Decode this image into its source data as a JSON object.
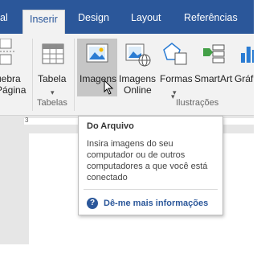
{
  "tabs": {
    "partial_left": "al",
    "inserir": "Inserir",
    "design": "Design",
    "layout": "Layout",
    "referencias": "Referências"
  },
  "ribbon": {
    "quebra_line1": "uebra",
    "quebra_line2": "Página",
    "tabela": "Tabela",
    "tabelas_group": "Tabelas",
    "imagens": "Imagens",
    "imagens_online_line1": "Imagens",
    "imagens_online_line2": "Online",
    "formas": "Formas",
    "smartart": "SmartArt",
    "graf_partial": "Gráf",
    "ilustracoes_group": "Ilustrações"
  },
  "ruler": {
    "mark": "3"
  },
  "tooltip": {
    "title": "Do Arquivo",
    "body": "Insira imagens do seu computador ou de outros computadores a que você está conectado",
    "link": "Dê-me mais informações"
  },
  "colors": {
    "accent": "#2b579a",
    "ribbon_bg": "#f2f2f2"
  }
}
